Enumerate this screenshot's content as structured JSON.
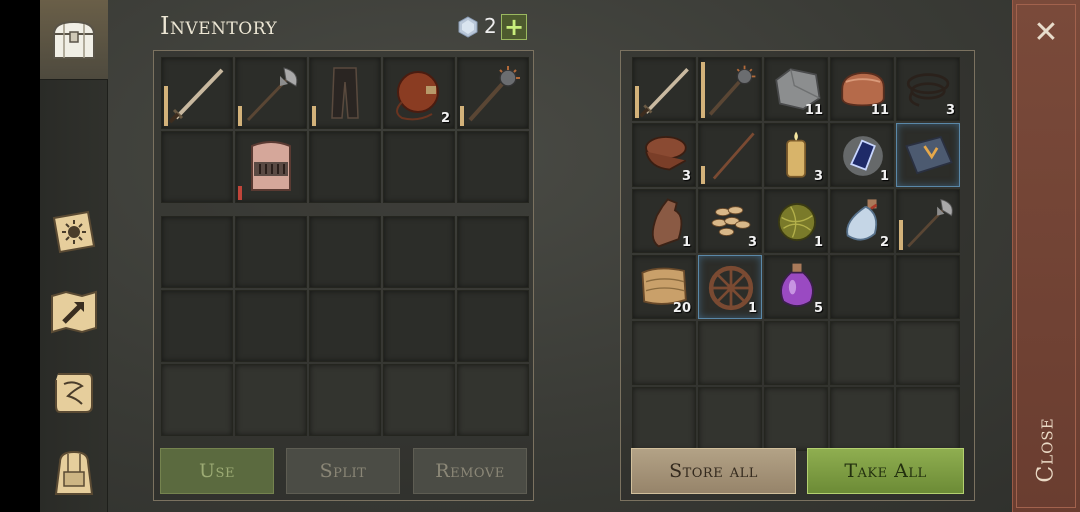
{
  "inventory": {
    "title": "Inventory",
    "gem_count": "2",
    "plus_label": "+",
    "equipped_row1": [
      {
        "icon": "sword-icon",
        "count": "",
        "durability": 0.6
      },
      {
        "icon": "halberd-icon",
        "count": "",
        "durability": 0.3
      },
      {
        "icon": "leather-pants-icon",
        "count": "",
        "durability": 0.3
      },
      {
        "icon": "leather-flask-icon",
        "count": "2",
        "durability": null
      },
      {
        "icon": "mace-icon",
        "count": "",
        "durability": 0.3
      }
    ],
    "equipped_row2": [
      {
        "icon": "empty"
      },
      {
        "icon": "great-helm-icon",
        "count": "",
        "durability": 0.2,
        "durability_color": "red"
      }
    ],
    "buttons": {
      "use": "Use",
      "split": "Split",
      "remove": "Remove"
    }
  },
  "storage": {
    "items": [
      {
        "icon": "sword-icon",
        "count": "",
        "durability": 0.5
      },
      {
        "icon": "mace-icon",
        "count": "",
        "durability": 0.9
      },
      {
        "icon": "stone-icon",
        "count": "11"
      },
      {
        "icon": "copper-ingot-icon",
        "count": "11"
      },
      {
        "icon": "rope-icon",
        "count": "3"
      },
      {
        "icon": "leather-icon",
        "count": "3"
      },
      {
        "icon": "stick-icon",
        "count": "",
        "durability": 0.3
      },
      {
        "icon": "candle-icon",
        "count": "3"
      },
      {
        "icon": "magic-crystal-icon",
        "count": "1"
      },
      {
        "icon": "book-icon",
        "count": "",
        "highlight": true
      },
      {
        "icon": "clay-bottle-icon",
        "count": "1"
      },
      {
        "icon": "seeds-icon",
        "count": "3"
      },
      {
        "icon": "hay-ball-icon",
        "count": "1"
      },
      {
        "icon": "potion-flask-icon",
        "count": "2"
      },
      {
        "icon": "halberd-icon",
        "count": "",
        "durability": 0.5
      },
      {
        "icon": "fabric-icon",
        "count": "20"
      },
      {
        "icon": "wheel-icon",
        "count": "1",
        "highlight": true
      },
      {
        "icon": "purple-potion-icon",
        "count": "5"
      }
    ],
    "buttons": {
      "store_all": "Store all",
      "take_all": "Take All"
    }
  },
  "close": {
    "label": "Close",
    "x_label": "✕"
  },
  "sidebar": {
    "items": [
      {
        "icon": "chest-icon",
        "active": true
      },
      {
        "icon": "sun-book-icon"
      },
      {
        "icon": "crafting-map-icon"
      },
      {
        "icon": "scroll-icon"
      },
      {
        "icon": "backpack-icon"
      }
    ]
  },
  "colors": {
    "accent_green": "#8fae50",
    "store_tan": "#b3a286",
    "close_red": "#7a4a3a"
  }
}
